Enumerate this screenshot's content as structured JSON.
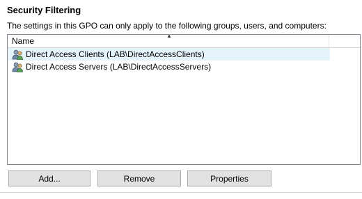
{
  "section": {
    "title": "Security Filtering",
    "description": "The settings in this GPO can only apply to the following groups, users, and computers:"
  },
  "list": {
    "column_header": "Name",
    "sort_indicator": "▲",
    "items": [
      {
        "label": "Direct Access Clients (LAB\\DirectAccessClients)",
        "icon": "group-icon",
        "selected": true
      },
      {
        "label": "Direct Access Servers (LAB\\DirectAccessServers)",
        "icon": "group-icon",
        "selected": false
      }
    ]
  },
  "buttons": {
    "add": "Add...",
    "remove": "Remove",
    "properties": "Properties"
  },
  "colors": {
    "selected_row": "#e5f3fb",
    "button_face": "#e1e1e1",
    "border": "#828790"
  }
}
